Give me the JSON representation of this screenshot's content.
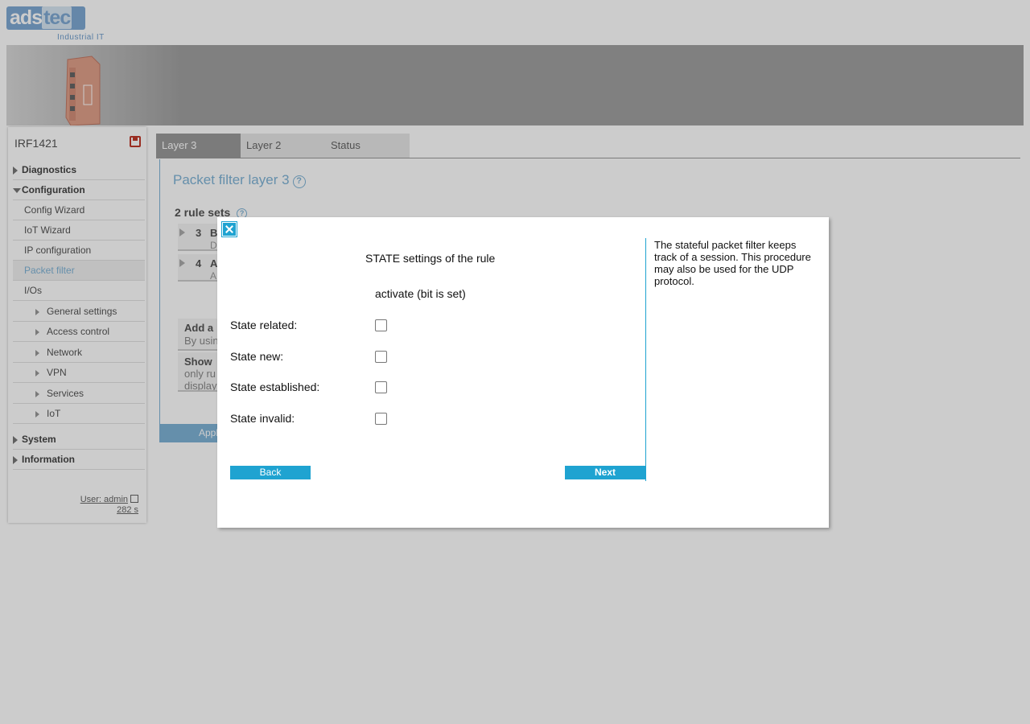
{
  "header": {
    "logo_ads": "ads",
    "logo_tec": "tec",
    "tagline": "Industrial IT"
  },
  "sidebar": {
    "device_name": "IRF1421",
    "items": [
      {
        "label": "Diagnostics",
        "level": 0,
        "expanded": false
      },
      {
        "label": "Configuration",
        "level": 0,
        "expanded": true
      },
      {
        "label": "Config Wizard",
        "level": 1
      },
      {
        "label": "IoT Wizard",
        "level": 1
      },
      {
        "label": "IP configuration",
        "level": 1
      },
      {
        "label": "Packet filter",
        "level": 1,
        "active": true
      },
      {
        "label": "I/Os",
        "level": 1
      },
      {
        "label": "General settings",
        "level": 2
      },
      {
        "label": "Access control",
        "level": 2
      },
      {
        "label": "Network",
        "level": 2
      },
      {
        "label": "VPN",
        "level": 2
      },
      {
        "label": "Services",
        "level": 2
      },
      {
        "label": "IoT",
        "level": 2
      },
      {
        "label": "System",
        "level": 0,
        "expanded": false
      },
      {
        "label": "Information",
        "level": 0,
        "expanded": false
      }
    ],
    "user_label": "User: admin",
    "session_timer": "282 s"
  },
  "tabs": [
    {
      "label": "Layer 3",
      "active": true
    },
    {
      "label": "Layer 2",
      "active": false
    },
    {
      "label": "Status",
      "active": false
    }
  ],
  "main": {
    "title": "Packet filter layer 3",
    "help_glyph": "?",
    "rulesets_title": "2 rule sets",
    "rules": [
      {
        "num": "3",
        "name": "B",
        "desc": "D"
      },
      {
        "num": "4",
        "name": "A",
        "desc": "A"
      }
    ],
    "add_box": {
      "title": "Add a",
      "sub": "By usin"
    },
    "show_box": {
      "title": "Show",
      "sub1": "only ru",
      "sub2": "display"
    },
    "apply_label": "Appl"
  },
  "dialog": {
    "title": "STATE settings of the rule",
    "column_header": "activate (bit is set)",
    "states": [
      {
        "label": "State related:",
        "checked": false
      },
      {
        "label": "State new:",
        "checked": false
      },
      {
        "label": "State established:",
        "checked": false
      },
      {
        "label": "State invalid:",
        "checked": false
      }
    ],
    "back_label": "Back",
    "next_label": "Next",
    "help_text": "The stateful packet filter keeps track of a session. This procedure may also be used for the UDP protocol.",
    "accent_color": "#1fa3d1"
  }
}
